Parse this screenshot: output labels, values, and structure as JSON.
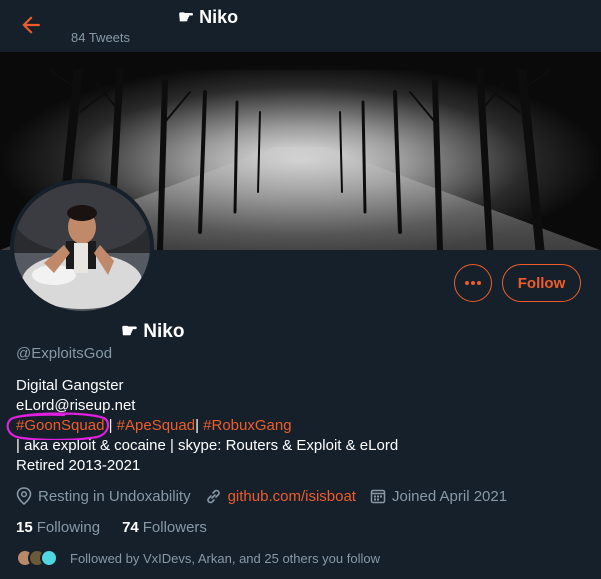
{
  "header": {
    "name": "☛ Niko",
    "tweets": "84 Tweets"
  },
  "profile": {
    "display_name": "☛ Niko",
    "handle": "@ExploitsGod",
    "follow_label": "Follow",
    "more_label": "•••"
  },
  "bio": {
    "line1": "Digital Gangster",
    "line2": "eLord@riseup.net",
    "tag1": "#GoonSquad",
    "sep1": " | ",
    "tag2": "#ApeSquad",
    "sep2": "| ",
    "tag3": "#RobuxGang",
    "line4": "| aka exploit & cocaine | skype: Routers & Exploit & eLord",
    "line5": "Retired 2013-2021"
  },
  "meta": {
    "location": "Resting in Undoxability",
    "link": "github.com/isisboat",
    "joined": "Joined April 2021"
  },
  "stats": {
    "following_count": "15",
    "following_label": "Following",
    "followers_count": "74",
    "followers_label": "Followers"
  },
  "followed_by": "Followed by VxIDevs, Arkan, and 25 others you follow",
  "colors": {
    "accent": "#ef5c2b",
    "background": "#15202b",
    "secondary_text": "#8899a6",
    "annotation_circle": "#e020e0"
  }
}
